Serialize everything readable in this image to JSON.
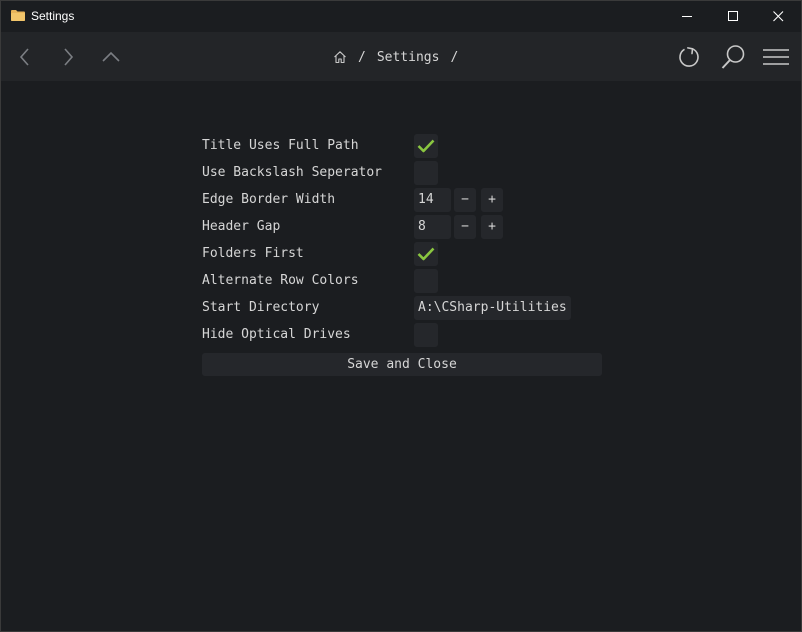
{
  "window": {
    "title": "Settings",
    "icon": "folder-icon"
  },
  "titlebar_buttons": {
    "minimize": "minimize-icon",
    "maximize": "maximize-icon",
    "close": "close-icon"
  },
  "nav": {
    "back": "chevron-left-icon",
    "forward": "chevron-right-icon",
    "up": "chevron-up-icon",
    "refresh": "refresh-icon",
    "search": "search-icon",
    "menu": "hamburger-menu-icon"
  },
  "breadcrumb": {
    "home": "home-icon",
    "sep1": "/",
    "current": "Settings",
    "sep2": "/"
  },
  "settings": {
    "title_full_path": {
      "label": "Title Uses Full Path",
      "checked": true
    },
    "backslash": {
      "label": "Use Backslash Seperator",
      "checked": false
    },
    "edge_border": {
      "label": "Edge Border Width",
      "value": "14",
      "minus": "−",
      "plus": "+"
    },
    "header_gap": {
      "label": "Header Gap",
      "value": "8",
      "minus": "−",
      "plus": "+"
    },
    "folders_first": {
      "label": "Folders First",
      "checked": true
    },
    "alt_rows": {
      "label": "Alternate Row Colors",
      "checked": false
    },
    "start_dir": {
      "label": "Start Directory",
      "value": "A:\\CSharp-Utilities"
    },
    "hide_optical": {
      "label": "Hide Optical Drives",
      "checked": false
    },
    "save_label": "Save and Close"
  },
  "colors": {
    "background": "#1b1d20",
    "navbar": "#232528",
    "control": "#25272b",
    "check": "#8ac640",
    "folder": "#e8b45a"
  }
}
